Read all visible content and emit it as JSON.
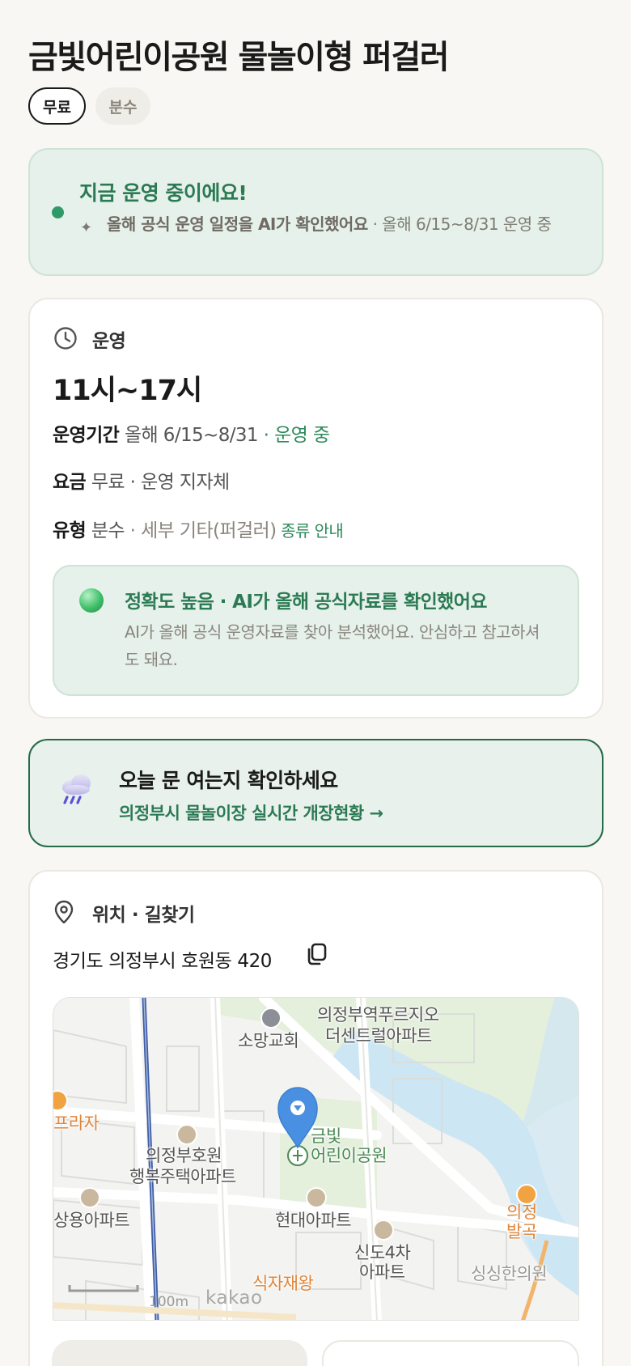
{
  "title": "금빛어린이공원 물놀이형 퍼걸러",
  "chips": {
    "price": "무료",
    "type": "분수"
  },
  "status": {
    "title": "지금 운영 중이에요!",
    "desc_bold": "올해 공식 운영 일정을 AI가 확인했어요",
    "desc_rest": " · 올해 6/15~8/31 운영 중"
  },
  "hours": {
    "label": "운영",
    "time": "11시~17시",
    "period_key": "운영기간",
    "period_val": " 올해 6/15~8/31",
    "period_status": " · 운영 중",
    "fee_key": "요금",
    "fee_val": " 무료 · 운영 지자체",
    "type_key": "유형",
    "type_val": " 분수",
    "type_detail": " · 세부 기타(퍼걸러)",
    "type_link": " 종류 안내"
  },
  "accuracy": {
    "title": "정확도 높음 · AI가 올해 공식자료를 확인했어요",
    "desc": "AI가 올해 공식 운영자료를 찾아 분석했어요. 안심하고 참고하셔도 돼요."
  },
  "open_check": {
    "title": "오늘 문 여는지 확인하세요",
    "link": "의정부시 물놀이장 실시간 개장현황 →"
  },
  "location": {
    "label": "위치 · 길찾기",
    "address": "경기도 의정부시 호원동 420",
    "map": {
      "labels": {
        "church": "소망교회",
        "apt1_line1": "의정부역푸르지오",
        "apt1_line2": "더센트럴아파트",
        "plaza": "프라자",
        "hoeon_line1": "의정부호원",
        "hoeon_line2": "행복주택아파트",
        "park_line1": "금빛",
        "park_line2": "어린이공원",
        "sangyong": "상용아파트",
        "hyundai": "현대아파트",
        "sindo_line1": "신도4차",
        "sindo_line2": "아파트",
        "market_line1": "의정",
        "market_line2": "발곡",
        "food": "식자재왕",
        "sinsegae": "싱싱한의원",
        "scale": "100m",
        "brand": "kakao"
      }
    }
  },
  "colors": {
    "accent_green": "#2c7a54",
    "status_bg": "#e5f1ea",
    "page_bg": "#f8f7f3",
    "pin_blue": "#4a90e2"
  }
}
